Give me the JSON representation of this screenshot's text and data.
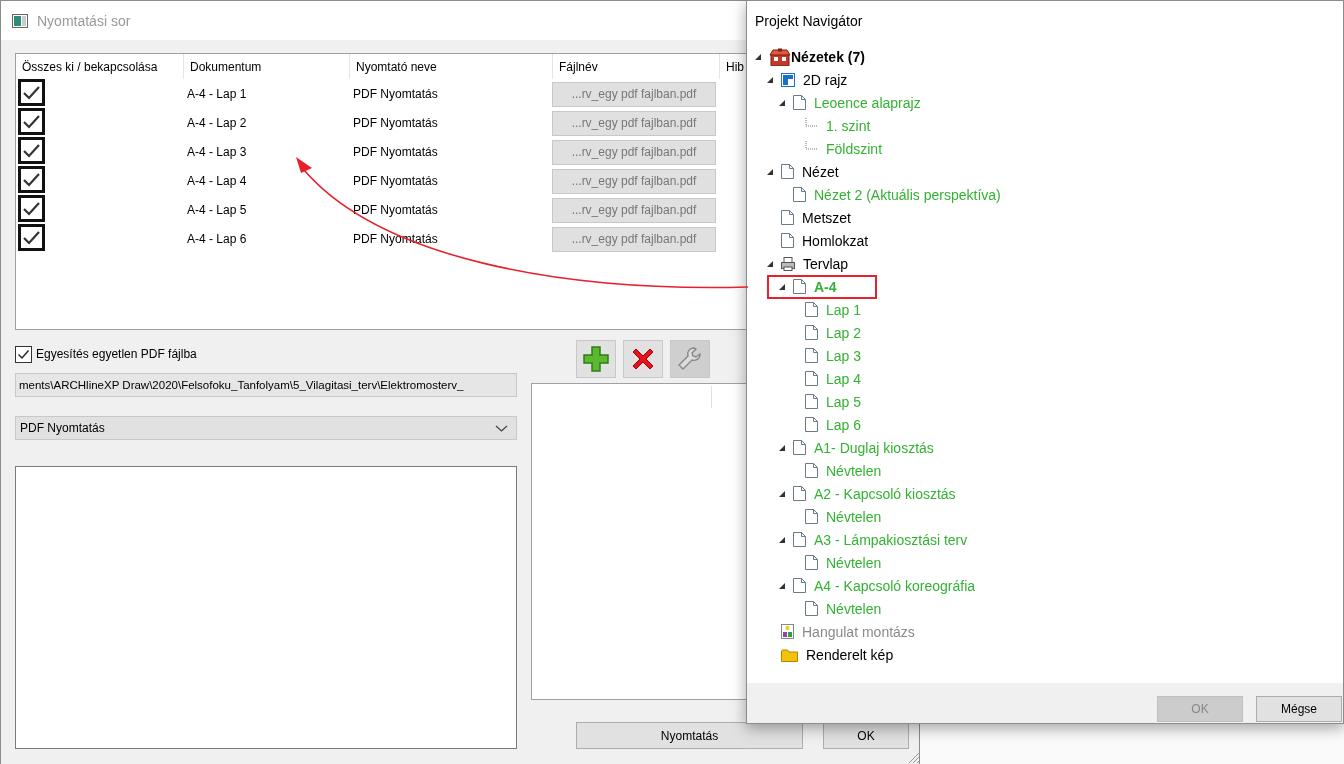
{
  "dialog": {
    "title": "Nyomtatási sor",
    "table": {
      "columns": [
        "Összes ki / bekapcsolása",
        "Dokumentum",
        "Nyomtató neve",
        "Fájlnév",
        "Hib"
      ],
      "rows": [
        {
          "checked": true,
          "document": "A-4 - Lap 1",
          "printer": "PDF Nyomtatás",
          "file": "...rv_egy pdf fajlban.pdf"
        },
        {
          "checked": true,
          "document": "A-4 - Lap 2",
          "printer": "PDF Nyomtatás",
          "file": "...rv_egy pdf fajlban.pdf"
        },
        {
          "checked": true,
          "document": "A-4 - Lap 3",
          "printer": "PDF Nyomtatás",
          "file": "...rv_egy pdf fajlban.pdf"
        },
        {
          "checked": true,
          "document": "A-4 - Lap 4",
          "printer": "PDF Nyomtatás",
          "file": "...rv_egy pdf fajlban.pdf"
        },
        {
          "checked": true,
          "document": "A-4 - Lap 5",
          "printer": "PDF Nyomtatás",
          "file": "...rv_egy pdf fajlban.pdf"
        },
        {
          "checked": true,
          "document": "A-4 - Lap 6",
          "printer": "PDF Nyomtatás",
          "file": "...rv_egy pdf fajlban.pdf"
        }
      ]
    },
    "merge_checkbox": {
      "label": "Egyesítés egyetlen PDF fájlba",
      "checked": true
    },
    "path_field": {
      "value": "ments\\ARCHlineXP Draw\\2020\\Felsofoku_Tanfolyam\\5_Vilagitasi_terv\\Elektromosterv_"
    },
    "printer_select": {
      "value": "PDF Nyomtatás"
    },
    "tool_buttons": [
      {
        "kind": "add",
        "disabled": false
      },
      {
        "kind": "remove",
        "disabled": false
      },
      {
        "kind": "settings",
        "disabled": true
      }
    ],
    "buttons": [
      {
        "label": "Nyomtatás"
      },
      {
        "label": "OK"
      }
    ]
  },
  "navigator": {
    "title": "Projekt Navigátor",
    "tree": [
      {
        "label": "Nézetek (7)",
        "kind": "views",
        "color": "#000000",
        "bold": true,
        "expanded": true,
        "children": [
          {
            "label": "2D rajz",
            "kind": "plan",
            "color": "#000000",
            "expanded": true,
            "children": [
              {
                "label": "Leoence alaprajz",
                "kind": "page",
                "color": "#33b233",
                "expanded": true,
                "children": [
                  {
                    "label": "1. szint",
                    "kind": "line",
                    "color": "#33b233",
                    "expanded": false
                  },
                  {
                    "label": "Földszint",
                    "kind": "line",
                    "color": "#33b233",
                    "expanded": false
                  }
                ]
              }
            ]
          },
          {
            "label": "Nézet",
            "kind": "page",
            "color": "#000000",
            "expanded": true,
            "children": [
              {
                "label": "Nézet 2 (Aktuális perspektíva)",
                "kind": "page",
                "color": "#33b233",
                "expanded": false
              }
            ]
          },
          {
            "label": "Metszet",
            "kind": "page",
            "color": "#000000",
            "expanded": false
          },
          {
            "label": "Homlokzat",
            "kind": "page",
            "color": "#000000",
            "expanded": false
          },
          {
            "label": "Tervlap",
            "kind": "printer",
            "color": "#000000",
            "expanded": true,
            "children": [
              {
                "label": "A-4",
                "kind": "page",
                "color": "#33b233",
                "bold": true,
                "highlighted": true,
                "expanded": true,
                "children": [
                  {
                    "label": "Lap 1",
                    "kind": "page",
                    "color": "#33b233",
                    "expanded": false
                  },
                  {
                    "label": "Lap 2",
                    "kind": "page",
                    "color": "#33b233",
                    "expanded": false
                  },
                  {
                    "label": "Lap 3",
                    "kind": "page",
                    "color": "#33b233",
                    "expanded": false
                  },
                  {
                    "label": "Lap 4",
                    "kind": "page",
                    "color": "#33b233",
                    "expanded": false
                  },
                  {
                    "label": "Lap 5",
                    "kind": "page",
                    "color": "#33b233",
                    "expanded": false
                  },
                  {
                    "label": "Lap 6",
                    "kind": "page",
                    "color": "#33b233",
                    "expanded": false
                  }
                ]
              },
              {
                "label": "A1- Duglaj kiosztás",
                "kind": "page",
                "color": "#33b233",
                "expanded": true,
                "children": [
                  {
                    "label": "Névtelen",
                    "kind": "page",
                    "color": "#33b233",
                    "expanded": false
                  }
                ]
              },
              {
                "label": "A2 - Kapcsoló kiosztás",
                "kind": "page",
                "color": "#33b233",
                "expanded": true,
                "children": [
                  {
                    "label": "Névtelen",
                    "kind": "page",
                    "color": "#33b233",
                    "expanded": false
                  }
                ]
              },
              {
                "label": "A3 - Lámpakiosztási terv",
                "kind": "page",
                "color": "#33b233",
                "expanded": true,
                "children": [
                  {
                    "label": "Névtelen",
                    "kind": "page",
                    "color": "#33b233",
                    "expanded": false
                  }
                ]
              },
              {
                "label": "A4 - Kapcsoló koreográfia",
                "kind": "page",
                "color": "#33b233",
                "expanded": true,
                "children": [
                  {
                    "label": "Névtelen",
                    "kind": "page",
                    "color": "#33b233",
                    "expanded": false
                  }
                ]
              }
            ]
          },
          {
            "label": "Hangulat montázs",
            "kind": "montage",
            "color": "#8a8a8a",
            "expanded": false
          },
          {
            "label": "Renderelt kép",
            "kind": "folder",
            "color": "#000000",
            "expanded": false
          }
        ]
      }
    ],
    "buttons": [
      {
        "label": "OK",
        "disabled": true
      },
      {
        "label": "Mégse",
        "disabled": false
      }
    ]
  },
  "annotations": [
    {
      "kind": "arrow"
    }
  ]
}
